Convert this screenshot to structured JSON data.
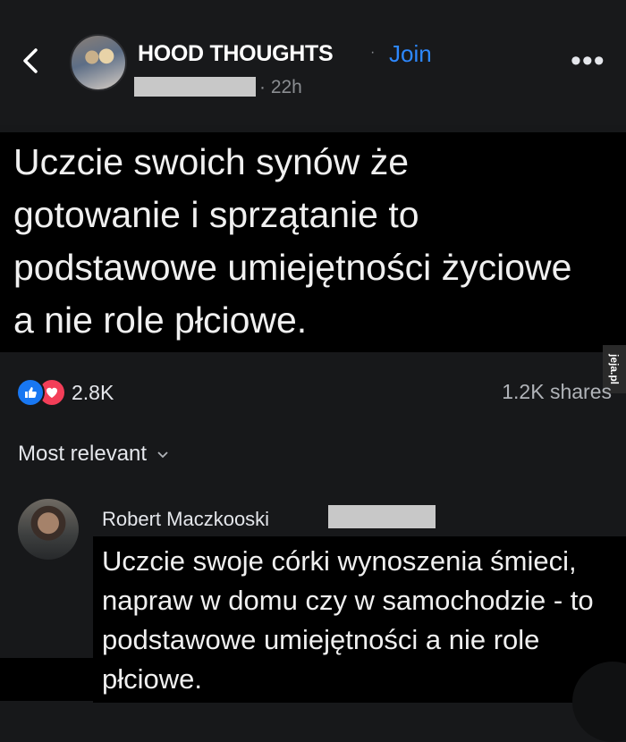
{
  "header": {
    "group_name": "HOOD THOUGHTS",
    "separator": "·",
    "join_label": "Join",
    "time": "· 22h",
    "more_label": "•••"
  },
  "post": {
    "text": "Uczcie swoich synów że gotowanie i sprzątanie to podstawowe umiejętności życiowe a nie role płciowe."
  },
  "watermark": "jeja.pl",
  "stats": {
    "reaction_count": "2.8K",
    "shares": "1.2K shares"
  },
  "comments_section": {
    "sort_label": "Most relevant"
  },
  "comment": {
    "author": "Robert Maczkooski",
    "text": "Uczcie swoje córki wynoszenia śmieci, napraw w domu czy w samochodzie - to podstawowe umiejętności a nie role płciowe."
  },
  "colors": {
    "background": "#17181a",
    "text_block": "#000000",
    "join_blue": "#2d88ff",
    "like_blue": "#1877f2",
    "love_red": "#f33e58"
  }
}
